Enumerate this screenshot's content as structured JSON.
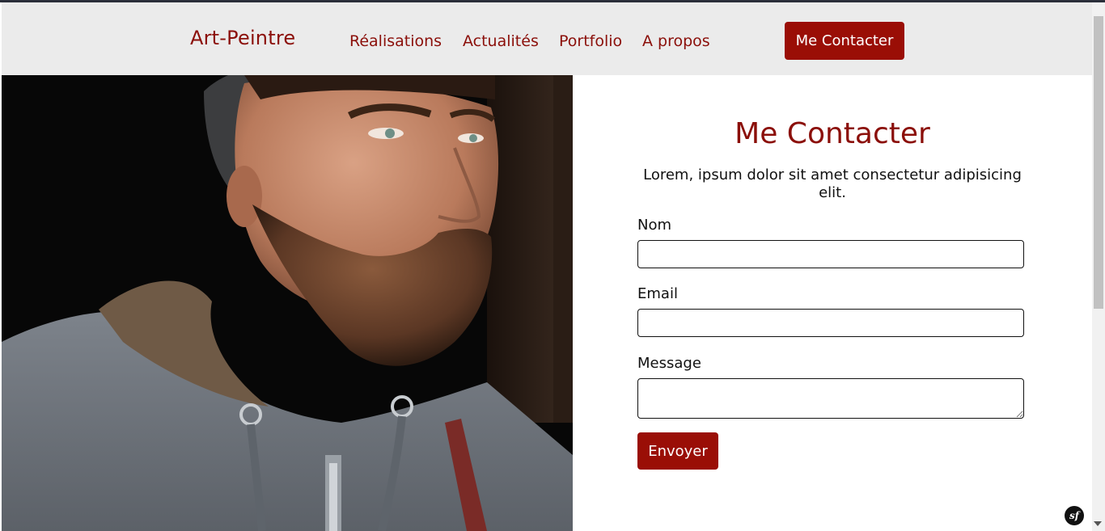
{
  "navbar": {
    "brand": "Art-Peintre",
    "links": [
      {
        "label": "Réalisations"
      },
      {
        "label": "Actualités"
      },
      {
        "label": "Portfolio"
      },
      {
        "label": "A propos"
      }
    ],
    "cta_label": "Me Contacter"
  },
  "contact": {
    "title": "Me Contacter",
    "intro": "Lorem, ipsum dolor sit amet consectetur adipisicing elit.",
    "fields": {
      "name_label": "Nom",
      "name_value": "",
      "email_label": "Email",
      "email_value": "",
      "message_label": "Message",
      "message_value": ""
    },
    "submit_label": "Envoyer"
  },
  "theme": {
    "brand_color": "#8b0f0a",
    "button_color": "#9a0e06",
    "navbar_bg": "#ebebeb"
  },
  "icons": {
    "debug_toolbar": "symfony-icon"
  },
  "debug_badge": "sf"
}
